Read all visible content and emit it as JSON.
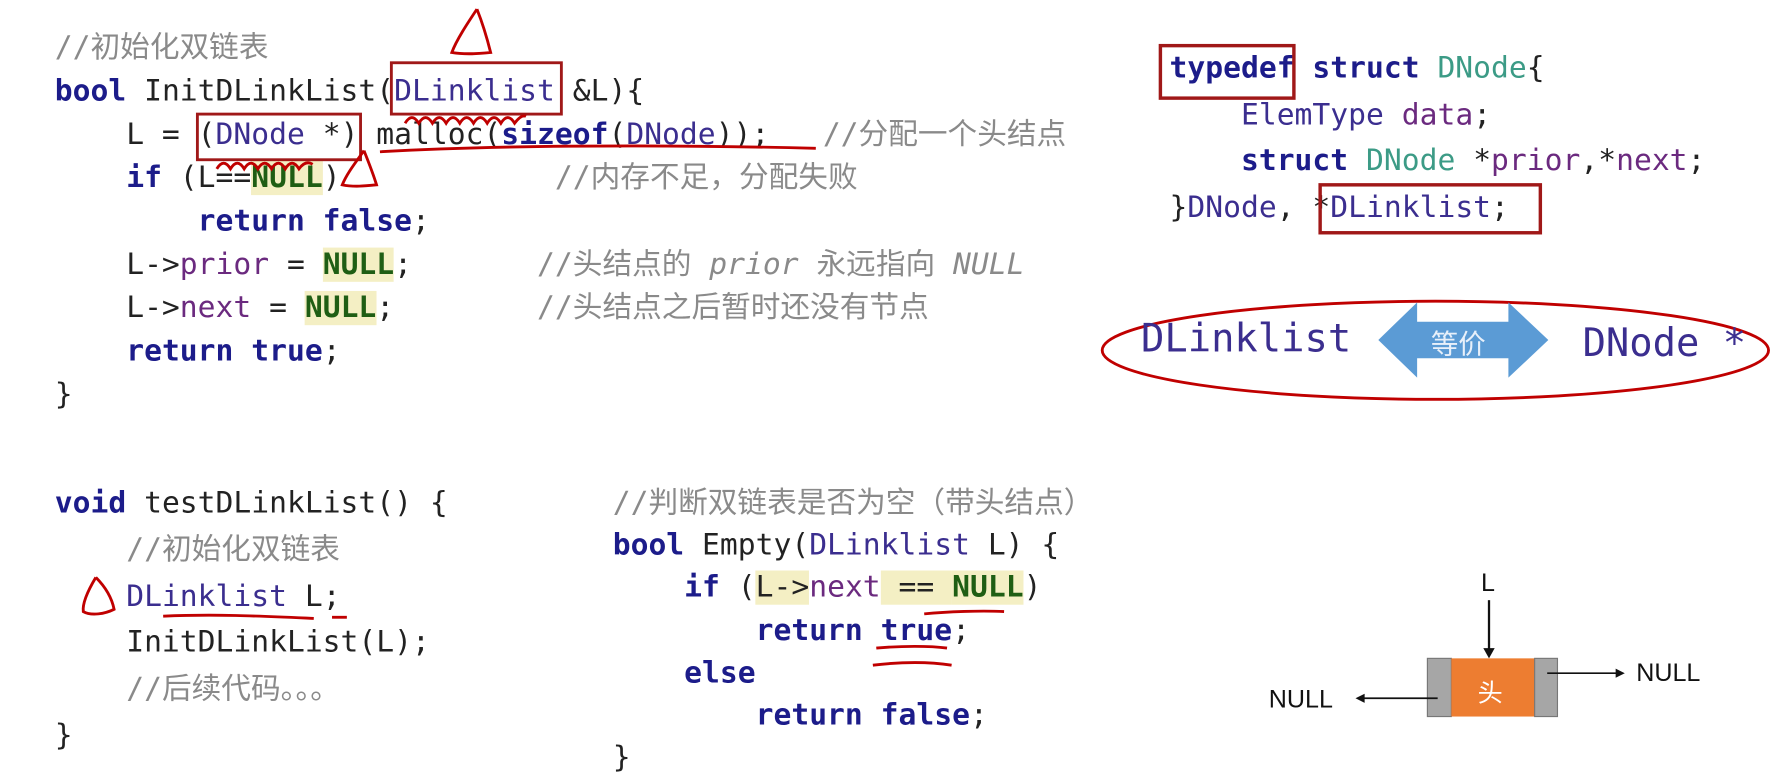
{
  "init_block": [
    [
      [
        "cm",
        "//初始化双链表"
      ]
    ],
    [
      [
        "kw",
        "bool"
      ],
      [
        "pl",
        " InitDLinkList("
      ],
      [
        "ty",
        "DLinklist"
      ],
      [
        "pl",
        " &L){"
      ]
    ],
    [
      [
        "pl",
        "    L = ("
      ],
      [
        "ty",
        "DNode"
      ],
      [
        "pl",
        " *) malloc("
      ],
      [
        "kw",
        "sizeof"
      ],
      [
        "pl",
        "("
      ],
      [
        "ty",
        "DNode"
      ],
      [
        "pl",
        "));   "
      ],
      [
        "cm",
        "//分配一个头结点"
      ]
    ],
    [
      [
        "pl",
        "    "
      ],
      [
        "kw",
        "if"
      ],
      [
        "pl",
        " (L=="
      ],
      [
        "nl",
        "NULL"
      ],
      [
        "pl",
        ")            "
      ],
      [
        "cm",
        "//内存不足，分配失败"
      ]
    ],
    [
      [
        "pl",
        "        "
      ],
      [
        "kw",
        "return false"
      ],
      [
        "pl",
        ";"
      ]
    ],
    [
      [
        "pl",
        "    L->"
      ],
      [
        "fld",
        "prior"
      ],
      [
        "pl",
        " = "
      ],
      [
        "nl",
        "NULL"
      ],
      [
        "pl",
        ";       "
      ],
      [
        "cm",
        "//头结点的 "
      ],
      [
        "cmi",
        "prior"
      ],
      [
        "cm",
        " 永远指向 "
      ],
      [
        "cmi",
        "NULL"
      ]
    ],
    [
      [
        "pl",
        "    L->"
      ],
      [
        "fld",
        "next"
      ],
      [
        "pl",
        " = "
      ],
      [
        "nl",
        "NULL"
      ],
      [
        "pl",
        ";        "
      ],
      [
        "cm",
        "//头结点之后暂时还没有节点"
      ]
    ],
    [
      [
        "pl",
        "    "
      ],
      [
        "kw",
        "return true"
      ],
      [
        "pl",
        ";"
      ]
    ],
    [
      [
        "pl",
        "}"
      ]
    ]
  ],
  "struct_block": [
    [
      [
        "kw",
        "typedef struct"
      ],
      [
        "pl",
        " "
      ],
      [
        "st",
        "DNode"
      ],
      [
        "pl",
        "{"
      ]
    ],
    [
      [
        "pl",
        "    "
      ],
      [
        "ty",
        "ElemType"
      ],
      [
        "pl",
        " "
      ],
      [
        "fld",
        "data"
      ],
      [
        "pl",
        ";"
      ]
    ],
    [
      [
        "pl",
        "    "
      ],
      [
        "kw",
        "struct"
      ],
      [
        "pl",
        " "
      ],
      [
        "st",
        "DNode"
      ],
      [
        "pl",
        " *"
      ],
      [
        "fld",
        "prior"
      ],
      [
        "pl",
        ",*"
      ],
      [
        "fld",
        "next"
      ],
      [
        "pl",
        ";"
      ]
    ],
    [
      [
        "pl",
        "}"
      ],
      [
        "ty",
        "DNode"
      ],
      [
        "pl",
        ", *"
      ],
      [
        "ty",
        "DLinklist"
      ],
      [
        "pl",
        ";"
      ]
    ]
  ],
  "test_block": [
    [
      [
        "kw",
        "void"
      ],
      [
        "pl",
        " testDLinkList() {"
      ]
    ],
    [
      [
        "pl",
        "    "
      ],
      [
        "cm",
        "//初始化双链表"
      ]
    ],
    [
      [
        "pl",
        "    "
      ],
      [
        "ty",
        "DLinklist"
      ],
      [
        "pl",
        " L;"
      ]
    ],
    [
      [
        "pl",
        "    InitDLinkList(L);"
      ]
    ],
    [
      [
        "pl",
        "    "
      ],
      [
        "cm",
        "//后续代码。。。"
      ]
    ],
    [
      [
        "pl",
        "}"
      ]
    ]
  ],
  "empty_block": [
    [
      [
        "cm",
        "//判断双链表是否为空（带头结点）"
      ]
    ],
    [
      [
        "kw",
        "bool"
      ],
      [
        "pl",
        " Empty("
      ],
      [
        "ty",
        "DLinklist"
      ],
      [
        "pl",
        " L) {"
      ]
    ],
    [
      [
        "pl",
        "    "
      ],
      [
        "kw",
        "if"
      ],
      [
        "pl",
        " ("
      ],
      [
        "hl",
        "L->"
      ],
      [
        "fld",
        "next"
      ],
      [
        "hl",
        " == "
      ],
      [
        "nl",
        "NULL"
      ],
      [
        "pl",
        ")"
      ]
    ],
    [
      [
        "pl",
        "        "
      ],
      [
        "kw",
        "return true"
      ],
      [
        "pl",
        ";"
      ]
    ],
    [
      [
        "pl",
        "    "
      ],
      [
        "kw",
        "else"
      ]
    ],
    [
      [
        "pl",
        "        "
      ],
      [
        "kw",
        "return false"
      ],
      [
        "pl",
        ";"
      ]
    ],
    [
      [
        "pl",
        "}"
      ]
    ]
  ],
  "equivalence": {
    "left": "DLinklist",
    "arrow_label": "等价",
    "right": "DNode *",
    "arrow_color": "#5b9bd5"
  },
  "diagram": {
    "pointer_label": "L",
    "node_label": "头",
    "next_label": "NULL",
    "prior_label": "NULL",
    "node_color": "#ed7d31",
    "side_color": "#a6a6a6"
  },
  "annotation_color": "#c00000"
}
